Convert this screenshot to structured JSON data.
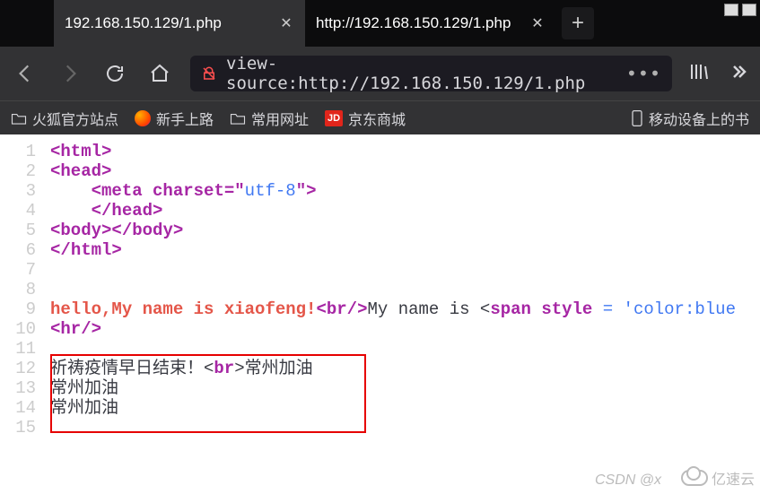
{
  "tabs": [
    {
      "title": "192.168.150.129/1.php",
      "active": true
    },
    {
      "title": "http://192.168.150.129/1.php",
      "active": false
    }
  ],
  "url": "view-source:http://192.168.150.129/1.php",
  "bookmarks": {
    "b0": "火狐官方站点",
    "b1": "新手上路",
    "b2": "常用网址",
    "b3": "京东商城",
    "jd": "JD",
    "mobile": "移动设备上的书"
  },
  "code": {
    "l1_open": "<",
    "l1_tag": "html",
    "l1_close": ">",
    "l2_open": "<",
    "l2_tag": "head",
    "l2_close": ">",
    "l3_indent": "    <",
    "l3_tag": "meta",
    "l3_sp": " ",
    "l3_attr": "charset",
    "l3_eq": "=\"",
    "l3_val": "utf-8",
    "l3_close": "\">",
    "l4_indent": "    </",
    "l4_tag": "head",
    "l4_close": ">",
    "l5_o1": "<",
    "l5_tag1": "body",
    "l5_c1": "></",
    "l5_tag2": "body",
    "l5_c2": ">",
    "l6_open": "</",
    "l6_tag": "html",
    "l6_close": ">",
    "l9_hello": "hello,My name is xiaofeng!",
    "l9_br_o": "<",
    "l9_br_t": "br",
    "l9_br_c": "/>",
    "l9_mid": "My name is <",
    "l9_span": "span",
    "l9_sp": " ",
    "l9_style": "style",
    "l9_eq": " = '",
    "l9_val": "color:blue",
    "l10_o": "<",
    "l10_t": "hr",
    "l10_c": "/>",
    "l12_text": "祈祷疫情早日结束！<",
    "l12_br": "br",
    "l12_c": ">常州加油",
    "l13": "常州加油",
    "l14": "常州加油"
  },
  "watermark": {
    "csdn": "CSDN @x",
    "yisu": "亿速云"
  },
  "gutter": {
    "n1": "1",
    "n2": "2",
    "n3": "3",
    "n4": "4",
    "n5": "5",
    "n6": "6",
    "n7": "7",
    "n8": "8",
    "n9": "9",
    "n10": "10",
    "n11": "11",
    "n12": "12",
    "n13": "13",
    "n14": "14",
    "n15": "15"
  }
}
